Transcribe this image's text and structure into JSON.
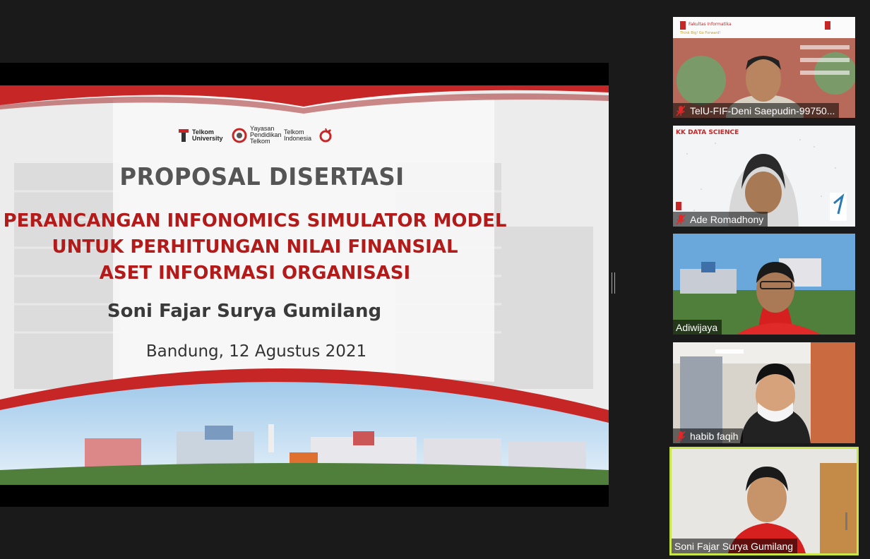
{
  "slide": {
    "logos": {
      "telkom_university": "Telkom University",
      "yayasan": "Yayasan Pendidikan Telkom",
      "telkom_indonesia": "Telkom Indonesia"
    },
    "title": "PROPOSAL DISERTASI",
    "subtitle_lines": [
      "PERANCANGAN INFONOMICS SIMULATOR MODEL",
      "UNTUK  PERHITUNGAN NILAI FINANSIAL",
      "ASET INFORMASI ORGANISASI"
    ],
    "author": "Soni Fajar Surya Gumilang",
    "date": "Bandung, 12 Agustus 2021"
  },
  "participants": [
    {
      "name": "TelU-FIF-Deni Saepudin-99750...",
      "muted": true,
      "background_label": "Fakultas Informatika",
      "background_tagline": "Think Big! Go Forward!",
      "icon": "person-video"
    },
    {
      "name": "Ade Romadhony",
      "muted": true,
      "background_label": "KK DATA SCIENCE",
      "icon": "person-video"
    },
    {
      "name": "Adiwijaya",
      "muted": false,
      "icon": "person-video"
    },
    {
      "name": "habib faqih",
      "muted": true,
      "icon": "person-video"
    },
    {
      "name": "Soni Fajar Surya Gumilang",
      "muted": false,
      "active_speaker": true,
      "icon": "person-video"
    }
  ],
  "colors": {
    "accent_red": "#b31b1b",
    "active_speaker_border": "#c8e64a",
    "muted_icon": "#e02828"
  }
}
